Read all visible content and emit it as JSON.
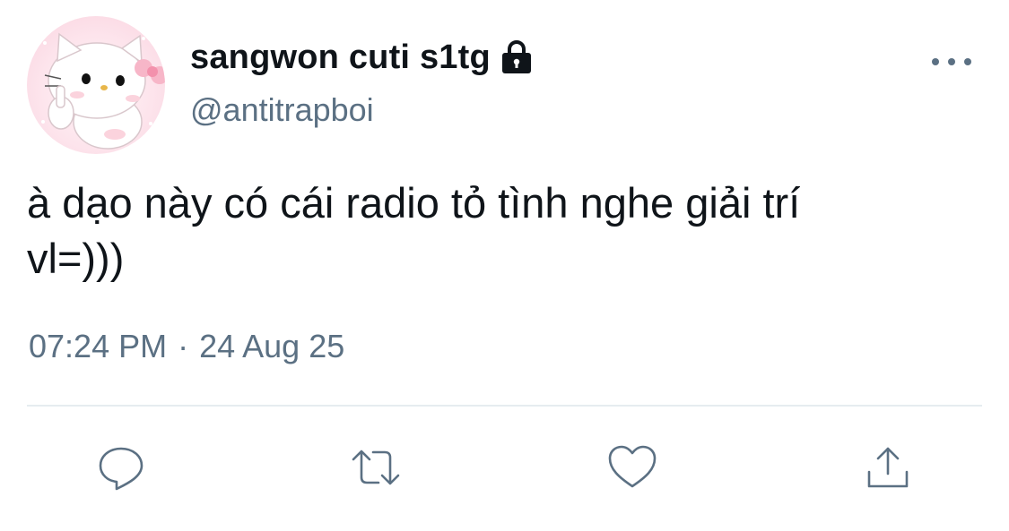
{
  "user": {
    "display_name": "sangwon cuti s1tg",
    "handle": "@antitrapboi",
    "protected_icon": "lock-icon",
    "avatar_icon": "hello-kitty-avatar"
  },
  "tweet": {
    "text": "à dạo này có cái radio tỏ tình nghe giải trí\nvl=)))",
    "time": "07:24 PM",
    "separator": "·",
    "date": "24 Aug 25"
  },
  "actions": [
    {
      "name": "reply",
      "icon": "reply-icon"
    },
    {
      "name": "retweet",
      "icon": "retweet-icon"
    },
    {
      "name": "like",
      "icon": "heart-icon"
    },
    {
      "name": "share",
      "icon": "share-icon"
    }
  ],
  "colors": {
    "text": "#0f1419",
    "secondary": "#5b7083",
    "divider": "#e6ecf0"
  }
}
